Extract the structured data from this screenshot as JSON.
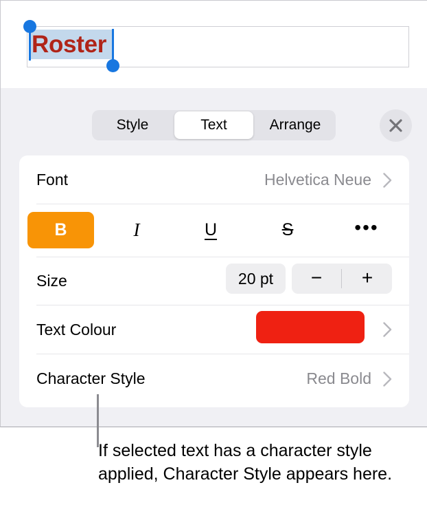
{
  "document": {
    "selected_text": "Roster",
    "text_color": "#b02418",
    "selection_highlight_color": "#c3d8ec",
    "handle_color": "#1877e0"
  },
  "panel": {
    "segmented_control": {
      "options": [
        "Style",
        "Text",
        "Arrange"
      ],
      "selected": "Text"
    },
    "close_label": "✕",
    "rows": {
      "font": {
        "label": "Font",
        "value": "Helvetica Neue"
      },
      "format_buttons": {
        "bold": "B",
        "italic": "I",
        "underline": "U",
        "strikethrough": "S",
        "more": "•••",
        "active": "bold",
        "active_color": "#f89406"
      },
      "size": {
        "label": "Size",
        "value": "20 pt",
        "decrement": "−",
        "increment": "+"
      },
      "text_colour": {
        "label": "Text Colour",
        "swatch_color": "#ef2112"
      },
      "character_style": {
        "label": "Character Style",
        "value": "Red Bold"
      }
    }
  },
  "callout": {
    "text": "If selected text has a character style applied, Character Style appears here."
  }
}
